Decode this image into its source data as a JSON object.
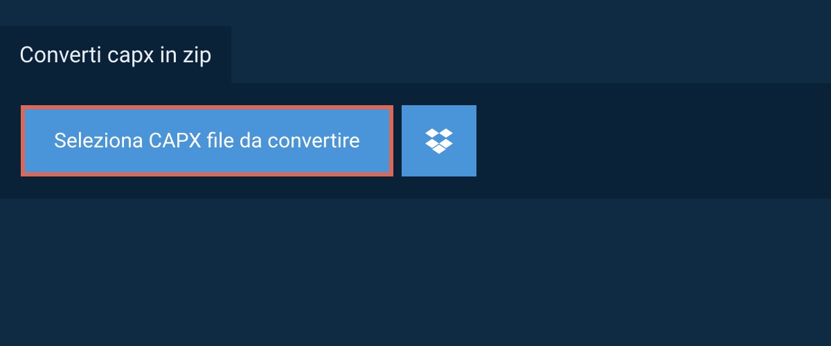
{
  "tab": {
    "title": "Converti capx in zip"
  },
  "actions": {
    "select_file_label": "Seleziona CAPX file da convertire"
  },
  "colors": {
    "background": "#0f2a43",
    "panel": "#0a2238",
    "button": "#4a94d9",
    "highlight_border": "#d96a5a",
    "text": "#ffffff"
  }
}
